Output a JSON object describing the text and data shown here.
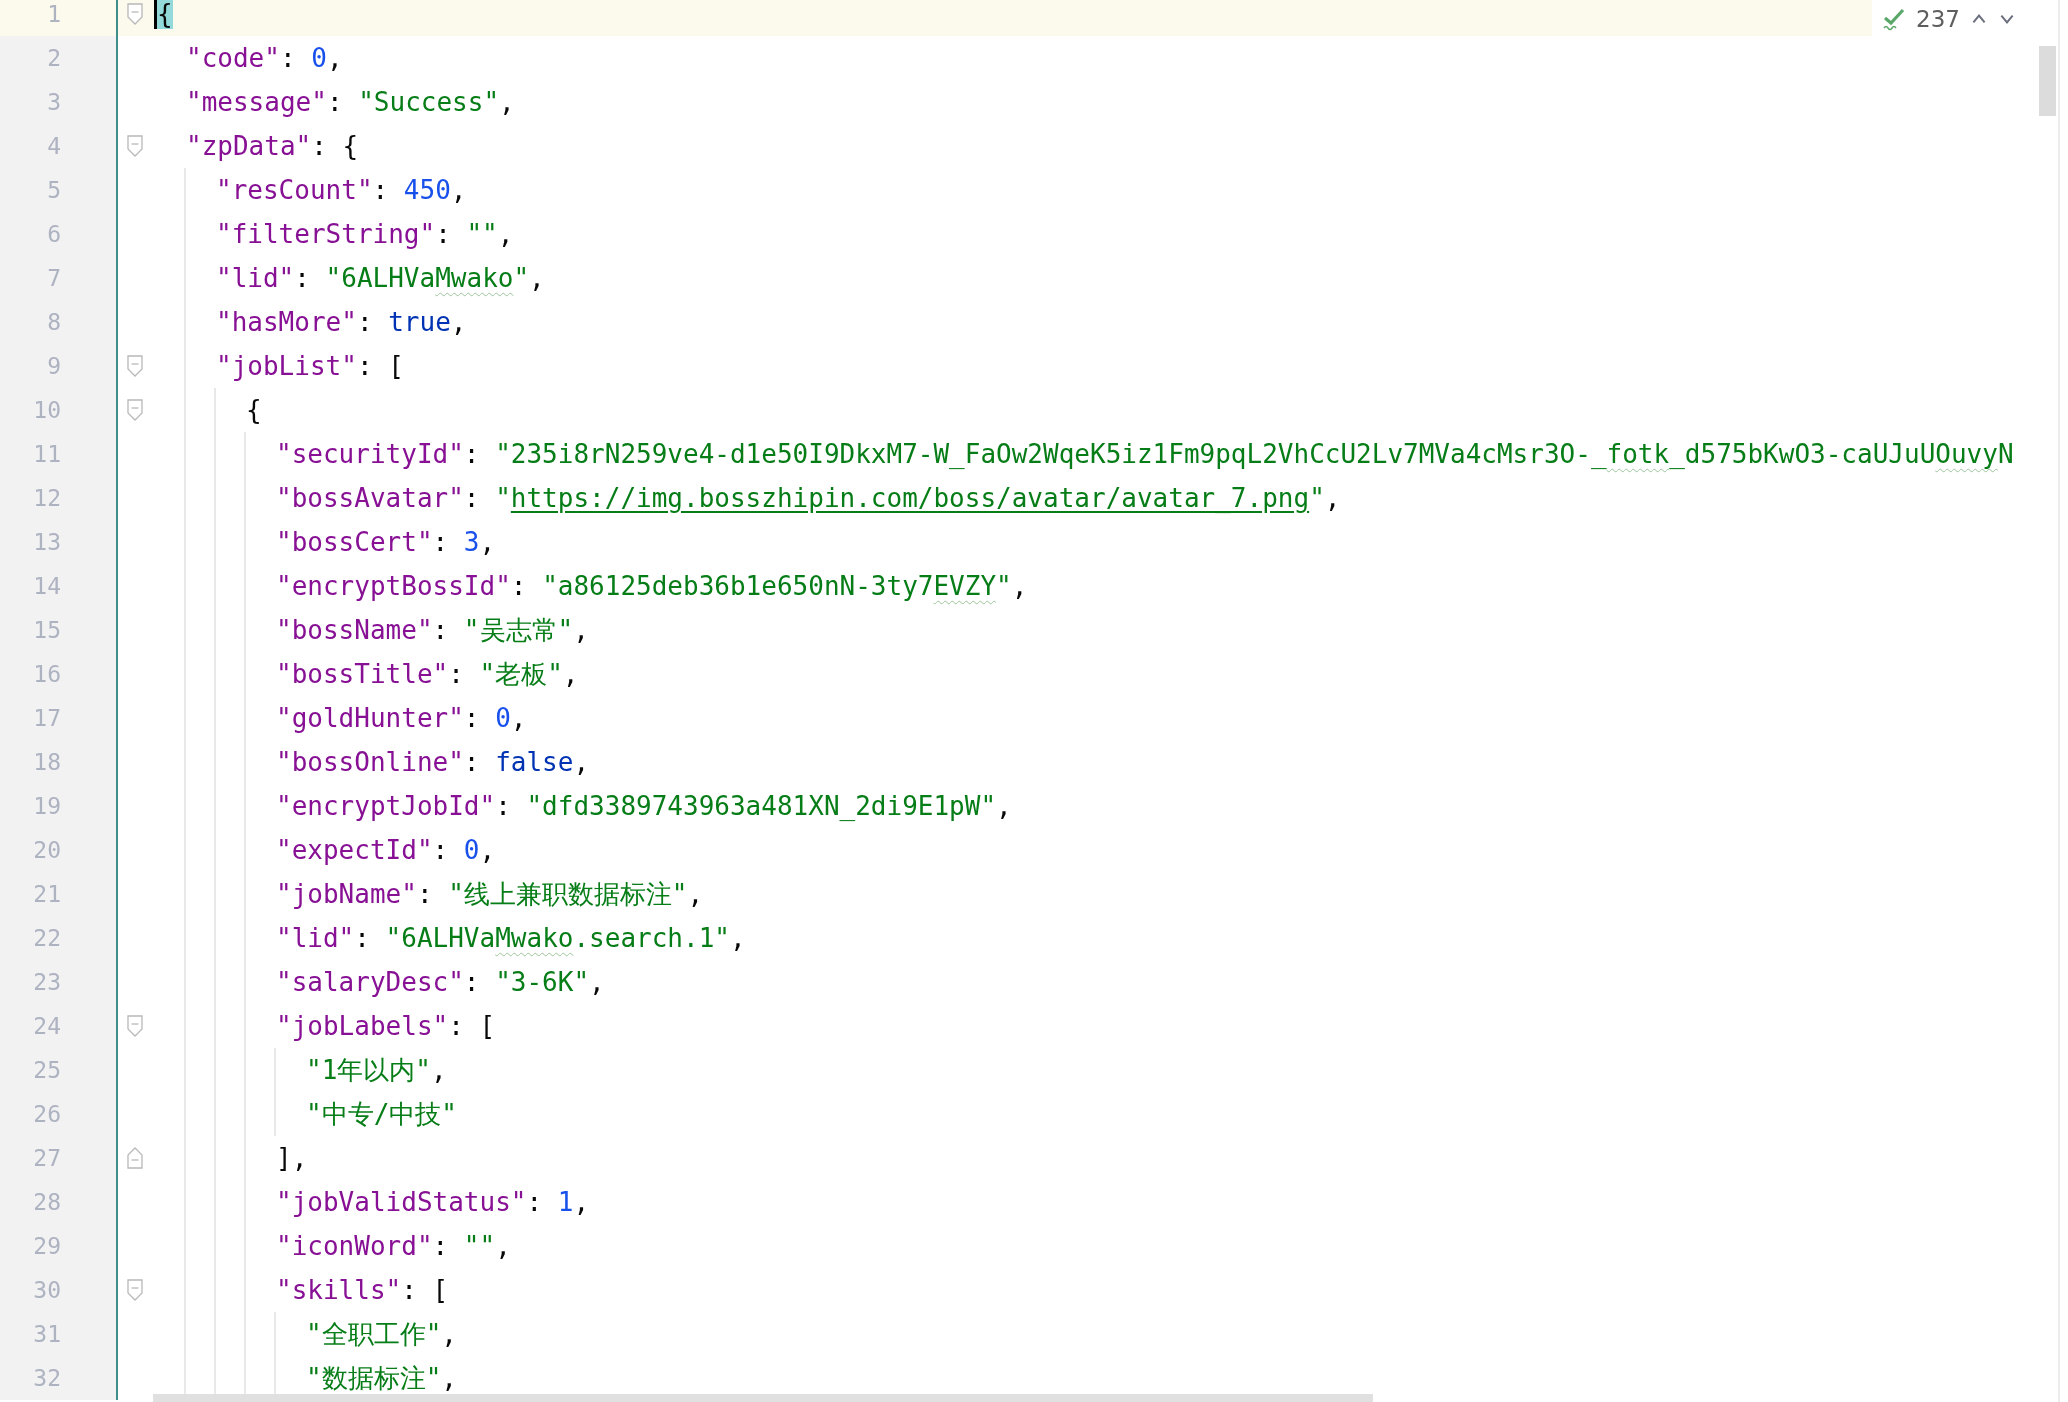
{
  "editor": {
    "lines": [
      {
        "number": "1",
        "current": true,
        "kind": "fold-start",
        "tokens": [
          {
            "kind": "brace-match",
            "text": "{"
          }
        ],
        "children": [
          {
            "number": "2",
            "current": false,
            "kind": "plain",
            "tokens": [
              {
                "kind": "key",
                "text": "\"code\""
              },
              {
                "kind": "punct",
                "text": ": "
              },
              {
                "kind": "num",
                "text": "0"
              },
              {
                "kind": "punct",
                "text": ","
              }
            ]
          },
          {
            "number": "3",
            "current": false,
            "kind": "plain",
            "tokens": [
              {
                "kind": "key",
                "text": "\"message\""
              },
              {
                "kind": "punct",
                "text": ": "
              },
              {
                "kind": "str",
                "text": "\"Success\""
              },
              {
                "kind": "punct",
                "text": ","
              }
            ]
          },
          {
            "number": "4",
            "current": false,
            "kind": "fold-start",
            "tokens": [
              {
                "kind": "key",
                "text": "\"zpData\""
              },
              {
                "kind": "punct",
                "text": ": {"
              }
            ],
            "children": [
              {
                "number": "5",
                "current": false,
                "kind": "plain",
                "tokens": [
                  {
                    "kind": "key",
                    "text": "\"resCount\""
                  },
                  {
                    "kind": "punct",
                    "text": ": "
                  },
                  {
                    "kind": "num",
                    "text": "450"
                  },
                  {
                    "kind": "punct",
                    "text": ","
                  }
                ]
              },
              {
                "number": "6",
                "current": false,
                "kind": "plain",
                "tokens": [
                  {
                    "kind": "key",
                    "text": "\"filterString\""
                  },
                  {
                    "kind": "punct",
                    "text": ": "
                  },
                  {
                    "kind": "str",
                    "text": "\"\""
                  },
                  {
                    "kind": "punct",
                    "text": ","
                  }
                ]
              },
              {
                "number": "7",
                "current": false,
                "kind": "plain",
                "tokens": [
                  {
                    "kind": "key",
                    "text": "\"lid\""
                  },
                  {
                    "kind": "punct",
                    "text": ": "
                  },
                  {
                    "kind": "str",
                    "text": "\"6ALHVa"
                  },
                  {
                    "kind": "typo",
                    "text": "Mwako"
                  },
                  {
                    "kind": "str",
                    "text": "\""
                  },
                  {
                    "kind": "punct",
                    "text": ","
                  }
                ]
              },
              {
                "number": "8",
                "current": false,
                "kind": "plain",
                "tokens": [
                  {
                    "kind": "key",
                    "text": "\"hasMore\""
                  },
                  {
                    "kind": "punct",
                    "text": ": "
                  },
                  {
                    "kind": "kw",
                    "text": "true"
                  },
                  {
                    "kind": "punct",
                    "text": ","
                  }
                ]
              },
              {
                "number": "9",
                "current": false,
                "kind": "fold-start",
                "tokens": [
                  {
                    "kind": "key",
                    "text": "\"jobList\""
                  },
                  {
                    "kind": "punct",
                    "text": ": ["
                  }
                ],
                "children": [
                  {
                    "number": "10",
                    "current": false,
                    "kind": "fold-start",
                    "tokens": [
                      {
                        "kind": "punct",
                        "text": "{"
                      }
                    ],
                    "children": [
                      {
                        "number": "11",
                        "current": false,
                        "kind": "plain",
                        "tokens": [
                          {
                            "kind": "key",
                            "text": "\"securityId\""
                          },
                          {
                            "kind": "punct",
                            "text": ": "
                          },
                          {
                            "kind": "str",
                            "text": "\"235i8rN259ve4-d1e50I9DkxM7-W_FaOw2WqeK5iz1Fm9pqL2VhCcU2Lv7MVa4cMsr3O-_"
                          },
                          {
                            "kind": "typo",
                            "text": "fotk"
                          },
                          {
                            "kind": "str",
                            "text": "_d575bKwO3-caUJuU"
                          },
                          {
                            "kind": "typo",
                            "text": "Ouvy"
                          },
                          {
                            "kind": "str",
                            "text": "N"
                          }
                        ]
                      },
                      {
                        "number": "12",
                        "current": false,
                        "kind": "plain",
                        "tokens": [
                          {
                            "kind": "key",
                            "text": "\"bossAvatar\""
                          },
                          {
                            "kind": "punct",
                            "text": ": "
                          },
                          {
                            "kind": "str",
                            "text": "\""
                          },
                          {
                            "kind": "link",
                            "text": "https://img.bosszhipin.com/boss/avatar/avatar_7.png"
                          },
                          {
                            "kind": "str",
                            "text": "\""
                          },
                          {
                            "kind": "punct",
                            "text": ","
                          }
                        ]
                      },
                      {
                        "number": "13",
                        "current": false,
                        "kind": "plain",
                        "tokens": [
                          {
                            "kind": "key",
                            "text": "\"bossCert\""
                          },
                          {
                            "kind": "punct",
                            "text": ": "
                          },
                          {
                            "kind": "num",
                            "text": "3"
                          },
                          {
                            "kind": "punct",
                            "text": ","
                          }
                        ]
                      },
                      {
                        "number": "14",
                        "current": false,
                        "kind": "plain",
                        "tokens": [
                          {
                            "kind": "key",
                            "text": "\"encryptBossId\""
                          },
                          {
                            "kind": "punct",
                            "text": ": "
                          },
                          {
                            "kind": "str",
                            "text": "\"a86125deb36b1e650nN-3ty7"
                          },
                          {
                            "kind": "typo",
                            "text": "EVZY"
                          },
                          {
                            "kind": "str",
                            "text": "\""
                          },
                          {
                            "kind": "punct",
                            "text": ","
                          }
                        ]
                      },
                      {
                        "number": "15",
                        "current": false,
                        "kind": "plain",
                        "tokens": [
                          {
                            "kind": "key",
                            "text": "\"bossName\""
                          },
                          {
                            "kind": "punct",
                            "text": ": "
                          },
                          {
                            "kind": "str",
                            "text": "\"吴志常\""
                          },
                          {
                            "kind": "punct",
                            "text": ","
                          }
                        ]
                      },
                      {
                        "number": "16",
                        "current": false,
                        "kind": "plain",
                        "tokens": [
                          {
                            "kind": "key",
                            "text": "\"bossTitle\""
                          },
                          {
                            "kind": "punct",
                            "text": ": "
                          },
                          {
                            "kind": "str",
                            "text": "\"老板\""
                          },
                          {
                            "kind": "punct",
                            "text": ","
                          }
                        ]
                      },
                      {
                        "number": "17",
                        "current": false,
                        "kind": "plain",
                        "tokens": [
                          {
                            "kind": "key",
                            "text": "\"goldHunter\""
                          },
                          {
                            "kind": "punct",
                            "text": ": "
                          },
                          {
                            "kind": "num",
                            "text": "0"
                          },
                          {
                            "kind": "punct",
                            "text": ","
                          }
                        ]
                      },
                      {
                        "number": "18",
                        "current": false,
                        "kind": "plain",
                        "tokens": [
                          {
                            "kind": "key",
                            "text": "\"bossOnline\""
                          },
                          {
                            "kind": "punct",
                            "text": ": "
                          },
                          {
                            "kind": "kw",
                            "text": "false"
                          },
                          {
                            "kind": "punct",
                            "text": ","
                          }
                        ]
                      },
                      {
                        "number": "19",
                        "current": false,
                        "kind": "plain",
                        "tokens": [
                          {
                            "kind": "key",
                            "text": "\"encryptJobId\""
                          },
                          {
                            "kind": "punct",
                            "text": ": "
                          },
                          {
                            "kind": "str",
                            "text": "\"dfd3389743963a481XN_2di9E1pW\""
                          },
                          {
                            "kind": "punct",
                            "text": ","
                          }
                        ]
                      },
                      {
                        "number": "20",
                        "current": false,
                        "kind": "plain",
                        "tokens": [
                          {
                            "kind": "key",
                            "text": "\"expectId\""
                          },
                          {
                            "kind": "punct",
                            "text": ": "
                          },
                          {
                            "kind": "num",
                            "text": "0"
                          },
                          {
                            "kind": "punct",
                            "text": ","
                          }
                        ]
                      },
                      {
                        "number": "21",
                        "current": false,
                        "kind": "plain",
                        "tokens": [
                          {
                            "kind": "key",
                            "text": "\"jobName\""
                          },
                          {
                            "kind": "punct",
                            "text": ": "
                          },
                          {
                            "kind": "str",
                            "text": "\"线上兼职数据标注\""
                          },
                          {
                            "kind": "punct",
                            "text": ","
                          }
                        ]
                      },
                      {
                        "number": "22",
                        "current": false,
                        "kind": "plain",
                        "tokens": [
                          {
                            "kind": "key",
                            "text": "\"lid\""
                          },
                          {
                            "kind": "punct",
                            "text": ": "
                          },
                          {
                            "kind": "str",
                            "text": "\"6ALHVa"
                          },
                          {
                            "kind": "typo",
                            "text": "Mwako"
                          },
                          {
                            "kind": "str",
                            "text": ".search.1\""
                          },
                          {
                            "kind": "punct",
                            "text": ","
                          }
                        ]
                      },
                      {
                        "number": "23",
                        "current": false,
                        "kind": "plain",
                        "tokens": [
                          {
                            "kind": "key",
                            "text": "\"salaryDesc\""
                          },
                          {
                            "kind": "punct",
                            "text": ": "
                          },
                          {
                            "kind": "str",
                            "text": "\"3-6K\""
                          },
                          {
                            "kind": "punct",
                            "text": ","
                          }
                        ]
                      },
                      {
                        "number": "24",
                        "current": false,
                        "kind": "fold-start",
                        "tokens": [
                          {
                            "kind": "key",
                            "text": "\"jobLabels\""
                          },
                          {
                            "kind": "punct",
                            "text": ": ["
                          }
                        ],
                        "children": [
                          {
                            "number": "25",
                            "current": false,
                            "kind": "plain",
                            "tokens": [
                              {
                                "kind": "str",
                                "text": "\"1年以内\""
                              },
                              {
                                "kind": "punct",
                                "text": ","
                              }
                            ]
                          },
                          {
                            "number": "26",
                            "current": false,
                            "kind": "plain",
                            "tokens": [
                              {
                                "kind": "str",
                                "text": "\"中专/中技\""
                              }
                            ]
                          }
                        ]
                      },
                      {
                        "number": "27",
                        "current": false,
                        "kind": "fold-end",
                        "tokens": [
                          {
                            "kind": "punct",
                            "text": "],"
                          }
                        ]
                      },
                      {
                        "number": "28",
                        "current": false,
                        "kind": "plain",
                        "tokens": [
                          {
                            "kind": "key",
                            "text": "\"jobValidStatus\""
                          },
                          {
                            "kind": "punct",
                            "text": ": "
                          },
                          {
                            "kind": "num",
                            "text": "1"
                          },
                          {
                            "kind": "punct",
                            "text": ","
                          }
                        ]
                      },
                      {
                        "number": "29",
                        "current": false,
                        "kind": "plain",
                        "tokens": [
                          {
                            "kind": "key",
                            "text": "\"iconWord\""
                          },
                          {
                            "kind": "punct",
                            "text": ": "
                          },
                          {
                            "kind": "str",
                            "text": "\"\""
                          },
                          {
                            "kind": "punct",
                            "text": ","
                          }
                        ]
                      },
                      {
                        "number": "30",
                        "current": false,
                        "kind": "fold-start",
                        "tokens": [
                          {
                            "kind": "key",
                            "text": "\"skills\""
                          },
                          {
                            "kind": "punct",
                            "text": ": ["
                          }
                        ],
                        "children": [
                          {
                            "number": "31",
                            "current": false,
                            "kind": "plain",
                            "tokens": [
                              {
                                "kind": "str",
                                "text": "\"全职工作\""
                              },
                              {
                                "kind": "punct",
                                "text": ","
                              }
                            ]
                          },
                          {
                            "number": "32",
                            "current": false,
                            "kind": "plain",
                            "tokens": [
                              {
                                "kind": "str",
                                "text": "\"数据标注\""
                              },
                              {
                                "kind": "punct",
                                "text": ","
                              }
                            ]
                          }
                        ]
                      }
                    ]
                  }
                ]
              }
            ]
          }
        ]
      }
    ]
  },
  "inspection_widget": {
    "count": "237"
  }
}
